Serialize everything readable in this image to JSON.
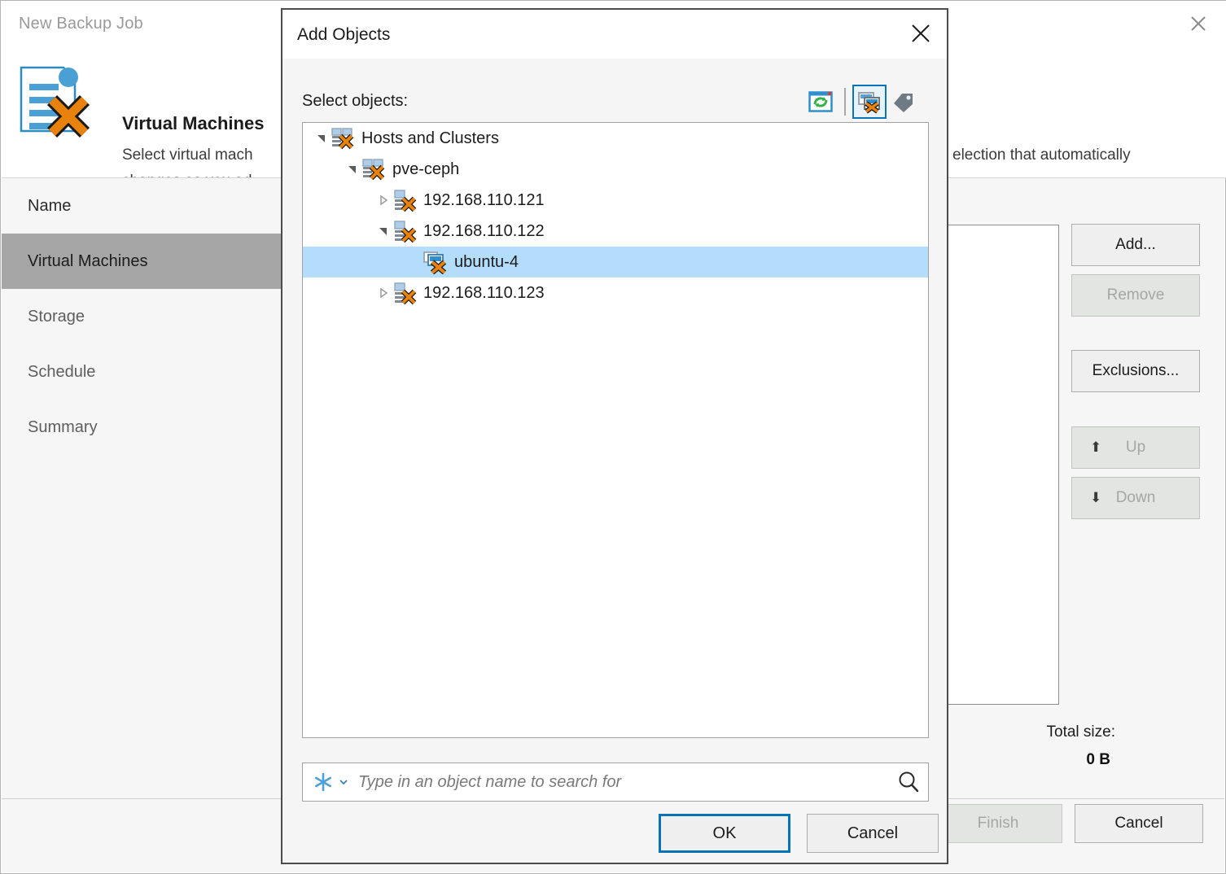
{
  "wizard": {
    "title": "New Backup Job",
    "header": {
      "title": "Virtual Machines",
      "desc_line1": "Select virtual mach",
      "desc_line2": "changes as you ad",
      "desc_right": "election that automatically"
    },
    "nav": [
      {
        "label": "Name",
        "active": false
      },
      {
        "label": "Virtual Machines",
        "active": true
      },
      {
        "label": "Storage",
        "active": false
      },
      {
        "label": "Schedule",
        "active": false
      },
      {
        "label": "Summary",
        "active": false
      }
    ],
    "side_buttons": [
      {
        "label": "Add...",
        "disabled": false,
        "icon": ""
      },
      {
        "label": "Remove",
        "disabled": true,
        "icon": ""
      },
      {
        "label": "Exclusions...",
        "disabled": false,
        "icon": ""
      },
      {
        "label": "Up",
        "disabled": true,
        "icon": "up-arrow-icon"
      },
      {
        "label": "Down",
        "disabled": true,
        "icon": "down-arrow-icon"
      }
    ],
    "total_size_label": "Total size:",
    "total_size_value": "0 B",
    "footer": {
      "finish_label": "Finish",
      "cancel_label": "Cancel"
    },
    "close_icon": "close-icon"
  },
  "dialog": {
    "title": "Add Objects",
    "close_icon": "close-icon",
    "select_label": "Select objects:",
    "toolbar": [
      {
        "name": "refresh-icon",
        "selected": false
      },
      {
        "name": "hosts-and-clusters-view-icon",
        "selected": true
      },
      {
        "name": "tag-view-icon",
        "selected": false
      }
    ],
    "tree": [
      {
        "label": "Hosts and Clusters",
        "depth": 0,
        "twisty": "expanded",
        "icon": "cluster-folder-icon",
        "selected": false
      },
      {
        "label": "pve-ceph",
        "depth": 1,
        "twisty": "expanded",
        "icon": "cluster-folder-icon",
        "selected": false
      },
      {
        "label": "192.168.110.121",
        "depth": 2,
        "twisty": "collapsed",
        "icon": "host-icon",
        "selected": false
      },
      {
        "label": "192.168.110.122",
        "depth": 2,
        "twisty": "expanded",
        "icon": "host-icon",
        "selected": false
      },
      {
        "label": "ubuntu-4",
        "depth": 3,
        "twisty": "none",
        "icon": "vm-icon",
        "selected": true
      },
      {
        "label": "192.168.110.123",
        "depth": 2,
        "twisty": "collapsed",
        "icon": "host-icon",
        "selected": false
      }
    ],
    "search": {
      "value": "",
      "placeholder": "Type in an object name to search for",
      "asterisk_icon": "asterisk-icon",
      "chevron_icon": "chevron-down-icon",
      "magnifier_icon": "search-icon"
    },
    "ok_label": "OK",
    "cancel_label": "Cancel"
  },
  "colors": {
    "accent": "#0a72b6",
    "selection": "#b3ddfb",
    "orange": "#e8820c",
    "nav_active": "#a6a6a6"
  }
}
